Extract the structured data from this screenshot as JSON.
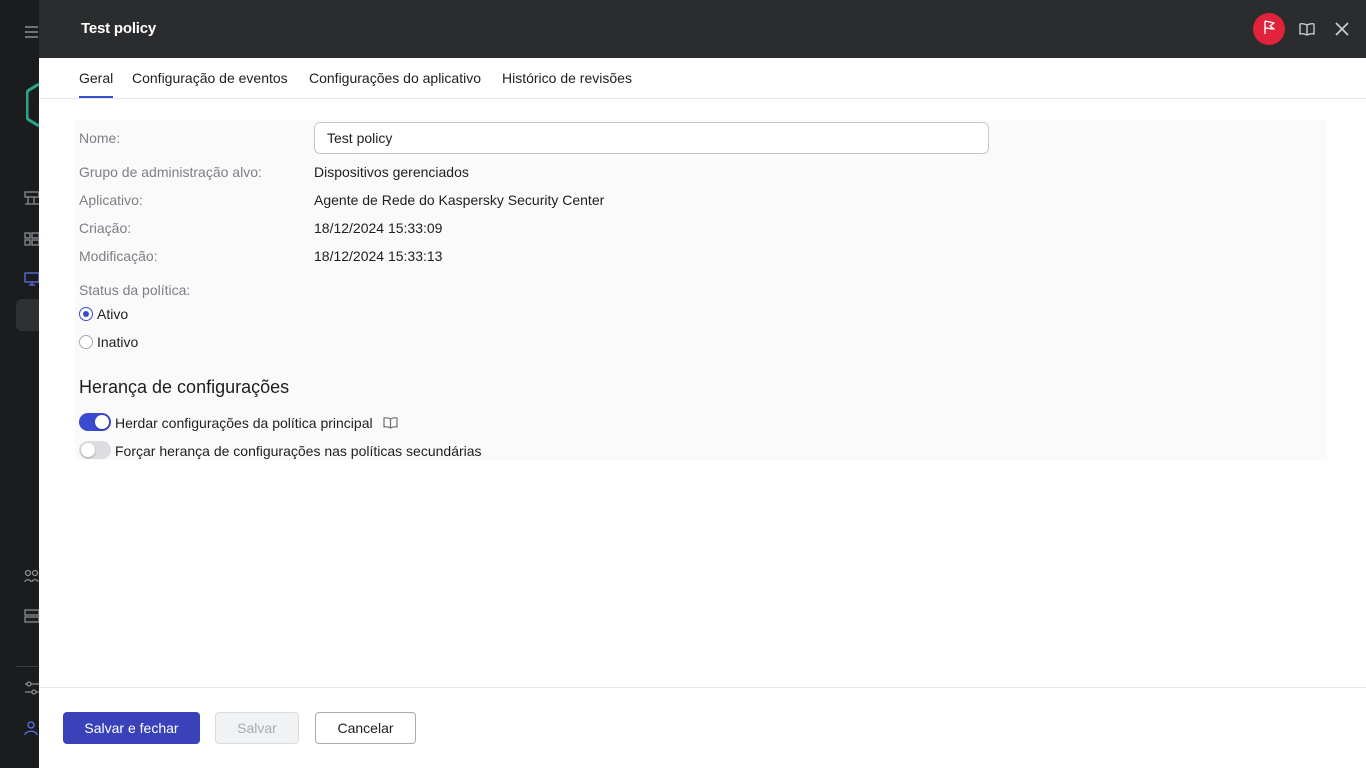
{
  "drawer": {
    "title": "Test policy"
  },
  "tabs": [
    {
      "label": "Geral",
      "active": true
    },
    {
      "label": "Configuração de eventos"
    },
    {
      "label": "Configurações do aplicativo"
    },
    {
      "label": "Histórico de revisões"
    }
  ],
  "fields": {
    "name_label": "Nome:",
    "name_value": "Test policy",
    "group_label": "Grupo de administração alvo:",
    "group_value": "Dispositivos gerenciados",
    "app_label": "Aplicativo:",
    "app_value": "Agente de Rede do Kaspersky Security Center",
    "created_label": "Criação:",
    "created_value": "18/12/2024 15:33:09",
    "modified_label": "Modificação:",
    "modified_value": "18/12/2024 15:33:13"
  },
  "status": {
    "label": "Status da política:",
    "options": [
      {
        "label": "Ativo",
        "checked": true
      },
      {
        "label": "Inativo",
        "checked": false
      }
    ]
  },
  "inheritance": {
    "title": "Herança de configurações",
    "toggles": [
      {
        "label": "Herdar configurações da política principal",
        "on": true
      },
      {
        "label": "Forçar herança de configurações nas políticas secundárias",
        "on": false
      }
    ]
  },
  "footer": {
    "save_close_label": "Salvar e fechar",
    "save_label": "Salvar",
    "cancel_label": "Cancelar"
  },
  "colors": {
    "accent": "#3b4bd0",
    "header_bg": "#2b2c2e",
    "flag_red": "#e0223a"
  },
  "icons": {
    "header": [
      "flag-icon",
      "book-icon",
      "close-icon"
    ],
    "sidebar": [
      "menu-icon",
      "logo-icon",
      "server-icon",
      "dashboard-icon",
      "monitor-icon",
      "users-icon",
      "storage-icon",
      "sliders-icon",
      "user-icon"
    ]
  }
}
